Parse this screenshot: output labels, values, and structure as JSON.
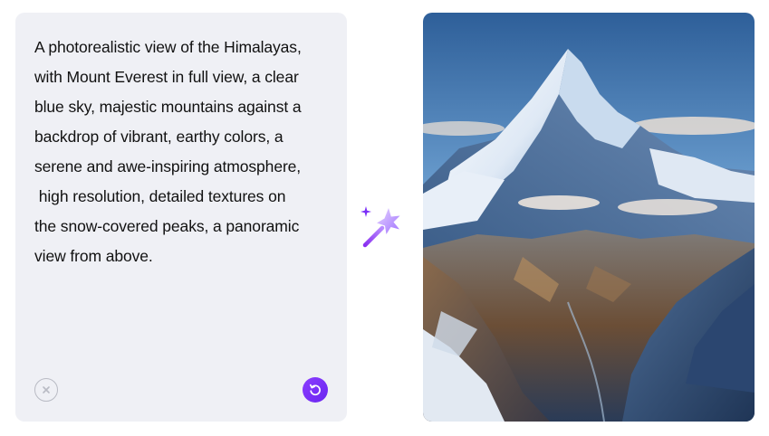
{
  "prompt": {
    "text": "A photorealistic view of the Himalayas,\nwith Mount Everest in full view, a clear\nblue sky, majestic mountains against a\nbackdrop of vibrant, earthy colors, a\nserene and awe-inspiring atmosphere,\n high resolution, detailed textures on\nthe snow-covered peaks, a panoramic\nview from above."
  },
  "controls": {
    "clear_icon": "close-circle-icon",
    "regenerate_icon": "refresh-icon"
  },
  "decor": {
    "wand_icon": "magic-wand-icon"
  },
  "result_image": {
    "subject": "mountain-landscape-image"
  },
  "colors": {
    "card_bg": "#eff0f5",
    "accent": "#7b2ff7",
    "text": "#111111"
  }
}
